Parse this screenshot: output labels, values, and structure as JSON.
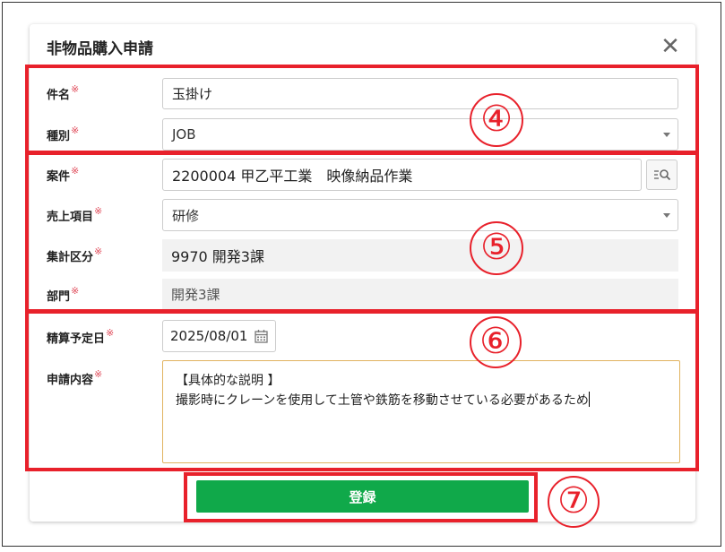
{
  "dialog": {
    "title": "非物品購入申請",
    "close_glyph": "✕"
  },
  "form": {
    "required_mark": "※",
    "subject": {
      "label": "件名",
      "value": "玉掛け"
    },
    "type": {
      "label": "種別",
      "value": "JOB"
    },
    "project": {
      "label": "案件",
      "value": "2200004 甲乙平工業　映像納品作業",
      "lookup_icon": "list-search-icon"
    },
    "sales_item": {
      "label": "売上項目",
      "value": "研修"
    },
    "aggregation": {
      "label": "集計区分",
      "value": "9970 開発3課"
    },
    "department": {
      "label": "部門",
      "value": "開発3課"
    },
    "settlement_date": {
      "label": "精算予定日",
      "value": "2025/08/01",
      "icon": "calendar-icon"
    },
    "content": {
      "label": "申請内容",
      "line1": "【具体的な説明 】",
      "line2": "撮影時にクレーンを使用して土管や鉄筋を移動させている必要があるため"
    }
  },
  "submit": {
    "label": "登録"
  },
  "annotations": {
    "step4": "④",
    "step5": "⑤",
    "step6": "⑥",
    "step7": "⑦"
  },
  "colors": {
    "highlight": "#e8212b",
    "submit": "#10a94a",
    "required": "#e04b5a"
  }
}
